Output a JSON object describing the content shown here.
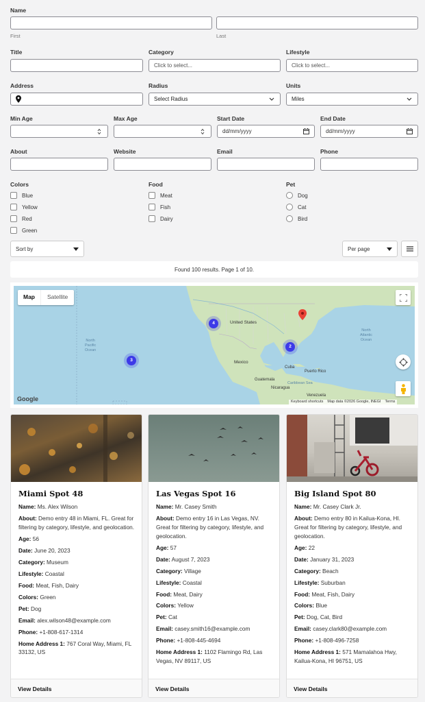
{
  "form": {
    "name_label": "Name",
    "first_sub": "First",
    "last_sub": "Last",
    "title_label": "Title",
    "category_label": "Category",
    "category_placeholder": "Click to select...",
    "lifestyle_label": "Lifestyle",
    "lifestyle_placeholder": "Click to select...",
    "address_label": "Address",
    "radius_label": "Radius",
    "radius_value": "Select Radius",
    "units_label": "Units",
    "units_value": "Miles",
    "min_age_label": "Min Age",
    "max_age_label": "Max Age",
    "start_date_label": "Start Date",
    "start_date_placeholder": "dd/mm/yyyy",
    "end_date_label": "End Date",
    "end_date_placeholder": "dd/mm/yyyy",
    "about_label": "About",
    "website_label": "Website",
    "email_label": "Email",
    "phone_label": "Phone",
    "colors_label": "Colors",
    "colors": [
      "Blue",
      "Yellow",
      "Red",
      "Green"
    ],
    "food_label": "Food",
    "food": [
      "Meat",
      "Fish",
      "Dairy"
    ],
    "pet_label": "Pet",
    "pets": [
      "Dog",
      "Cat",
      "Bird"
    ]
  },
  "toolbar": {
    "sort_label": "Sort by",
    "per_page_label": "Per page"
  },
  "results": {
    "summary": "Found 100 results. Page 1 of 10."
  },
  "map": {
    "tab_map": "Map",
    "tab_satellite": "Satellite",
    "label_us": "United States",
    "label_mexico": "Mexico",
    "label_cuba": "Cuba",
    "label_pr": "Puerto Rico",
    "label_guatemala": "Guatemala",
    "label_nicaragua": "Nicaragua",
    "label_venezuela": "Venezuela",
    "label_caribbean": "Caribbean Sea",
    "label_npo": "North\nPacific\nOcean",
    "label_nao": "North\nAtlantic\nOcean",
    "cluster_west": "4",
    "cluster_east": "2",
    "cluster_hawaii": "3",
    "google": "Google",
    "keyboard": "Keyboard shortcuts",
    "mapdata": "Map data ©2026 Google, INEGI",
    "terms": "Terms",
    "colors": {
      "water": "#a9d3e6",
      "land": "#cfe3bb",
      "cluster": "#3d3ae8"
    }
  },
  "cards": [
    {
      "title": "Miami Spot 48",
      "name": "Ms. Alex Wilson",
      "about": "Demo entry 48 in Miami, FL. Great for filtering by category, lifestyle, and geolocation.",
      "age": "56",
      "date": "June 20, 2023",
      "category": "Museum",
      "lifestyle": "Coastal",
      "food": "Meat, Fish, Dairy",
      "colors": "Green",
      "pet": "Dog",
      "email": "alex.wilson48@example.com",
      "phone": "+1-808-617-1314",
      "address": "767 Coral Way, Miami, FL 33132, US",
      "cta": "View Details"
    },
    {
      "title": "Las Vegas Spot 16",
      "name": "Mr. Casey Smith",
      "about": "Demo entry 16 in Las Vegas, NV. Great for filtering by category, lifestyle, and geolocation.",
      "age": "57",
      "date": "August 7, 2023",
      "category": "Village",
      "lifestyle": "Coastal",
      "food": "Meat, Dairy",
      "colors": "Yellow",
      "pet": "Cat",
      "email": "casey.smith16@example.com",
      "phone": "+1-808-445-4694",
      "address": "1102 Flamingo Rd, Las Vegas, NV 89117, US",
      "cta": "View Details"
    },
    {
      "title": "Big Island Spot 80",
      "name": "Mr. Casey Clark Jr.",
      "about": "Demo entry 80 in Kailua-Kona, HI. Great for filtering by category, lifestyle, and geolocation.",
      "age": "22",
      "date": "January 31, 2023",
      "category": "Beach",
      "lifestyle": "Suburban",
      "food": "Meat, Fish, Dairy",
      "colors": "Blue",
      "pet": "Dog, Cat, Bird",
      "email": "casey.clark80@example.com",
      "phone": "+1-808-496-7258",
      "address": "571 Mamalahoa Hwy, Kailua-Kona, HI 96751, US",
      "cta": "View Details"
    }
  ],
  "field_labels": {
    "name": "Name:",
    "about": "About:",
    "age": "Age:",
    "date": "Date:",
    "category": "Category:",
    "lifestyle": "Lifestyle:",
    "food": "Food:",
    "colors": "Colors:",
    "pet": "Pet:",
    "email": "Email:",
    "phone": "Phone:",
    "address": "Home Address 1:"
  }
}
